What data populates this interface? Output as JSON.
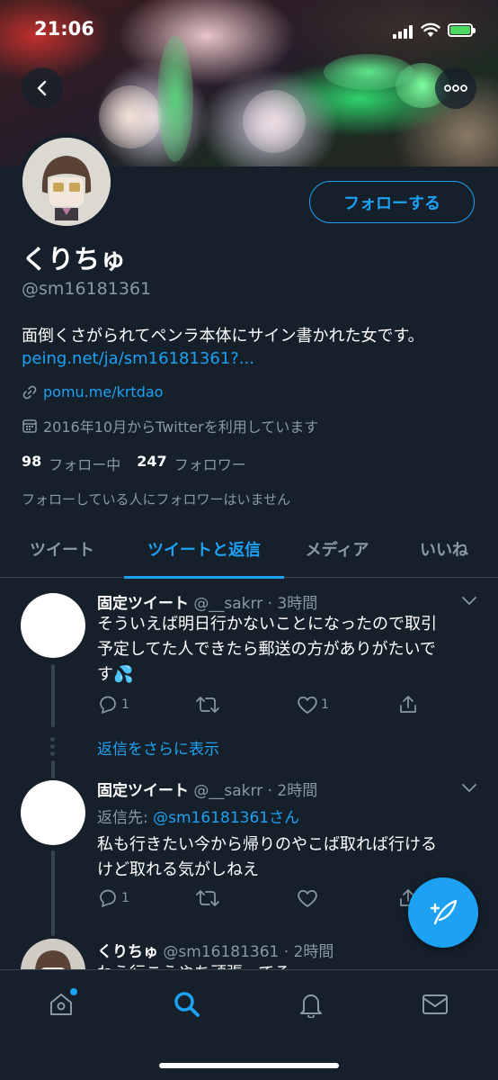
{
  "status_bar": {
    "time": "21:06"
  },
  "profile": {
    "display_name": "くりちゅ",
    "handle": "@sm16181361",
    "follow_label": "フォローする",
    "bio": "面倒くさがられてペンラ本体にサイン書かれた女です。",
    "bio_link": "peing.net/ja/sm16181361?...",
    "url": "pomu.me/krtdao",
    "joined": "2016年10月からTwitterを利用しています",
    "following_count": "98",
    "following_label": "フォロー中",
    "followers_count": "247",
    "followers_label": "フォロワー",
    "no_known_followers": "フォローしている人にフォロワーはいません"
  },
  "tabs": [
    {
      "label": "ツイート",
      "active": false
    },
    {
      "label": "ツイートと返信",
      "active": true
    },
    {
      "label": "メディア",
      "active": false
    },
    {
      "label": "いいね",
      "active": false
    }
  ],
  "tweets": [
    {
      "name": "固定ツイート",
      "handle": "@__sakrr",
      "time": "· 3時間",
      "text_line1": "そういえば明日行かないことになったので取引",
      "text_line2": "予定してた人できたら郵送の方がありがたいで",
      "text_line3": "す💦",
      "replies": "1",
      "retweets": "",
      "likes": "1"
    },
    {
      "name": "固定ツイート",
      "handle": "@__sakrr",
      "time": "· 2時間",
      "reply_prefix": "返信先: ",
      "reply_to": "@sm16181361さん",
      "text_line1": "私も行きたい今から帰りのやこば取れば行ける",
      "text_line2": "けど取れる気がしねえ",
      "replies": "1",
      "retweets": "",
      "likes": ""
    },
    {
      "name": "くりちゅ",
      "handle": "@sm16181361",
      "time": "· 2時間",
      "text_partial": "わう行こうやち頑張ってる"
    }
  ],
  "show_more_replies": "返信をさらに表示",
  "icons": {
    "back": "chevron-left-icon",
    "more": "more-horizontal-icon",
    "link": "link-icon",
    "calendar": "calendar-icon",
    "reply": "reply-icon",
    "retweet": "retweet-icon",
    "like": "heart-icon",
    "share": "share-icon",
    "compose": "compose-feather-icon",
    "home": "home-icon",
    "search": "search-icon",
    "notifications": "bell-icon",
    "messages": "mail-icon"
  },
  "colors": {
    "background": "#15202b",
    "accent": "#1da1f2",
    "secondary_text": "#8899a6",
    "divider": "#38444d"
  }
}
